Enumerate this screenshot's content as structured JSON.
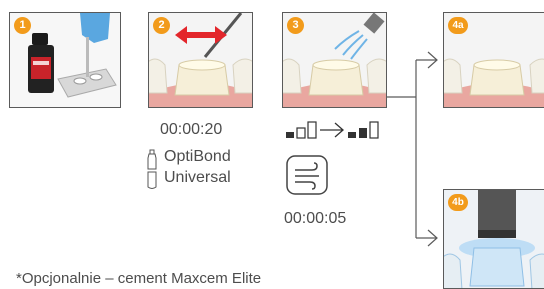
{
  "steps": [
    {
      "badge": "1"
    },
    {
      "badge": "2"
    },
    {
      "badge": "3"
    },
    {
      "badge": "4a"
    },
    {
      "badge": "4b"
    }
  ],
  "step2": {
    "time": "00:00:20",
    "product_line1": "OptiBond",
    "product_line2": "Universal"
  },
  "step3": {
    "time": "00:00:05"
  },
  "footnote": "*Opcjonalnie – cement Maxcem Elite",
  "colors": {
    "accent_orange": "#f29b1b",
    "arrow_red": "#e3262b",
    "stroke_gray": "#5a5a5a"
  }
}
